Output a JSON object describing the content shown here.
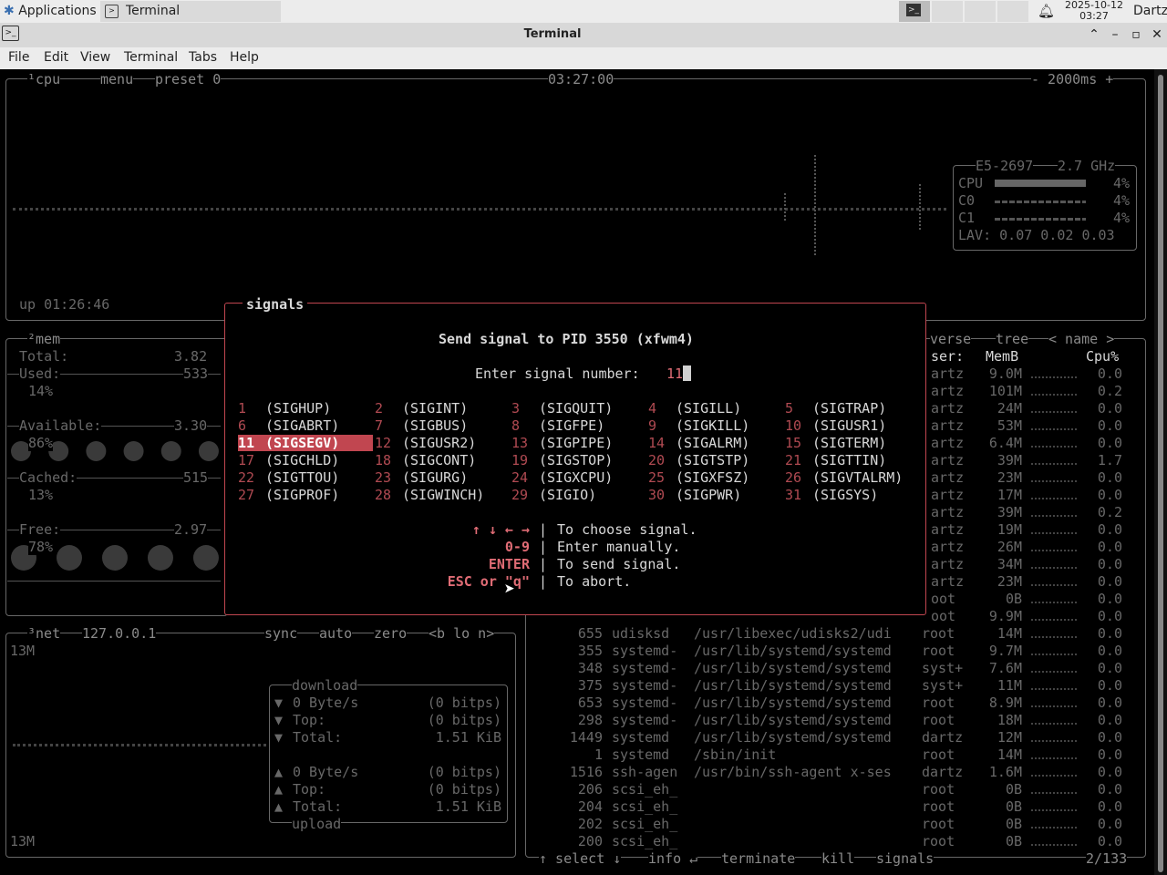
{
  "taskbar": {
    "applications_label": "Applications",
    "task_label": "Terminal",
    "date": "2025-10-12",
    "time": "03:27",
    "user": "Dartz"
  },
  "window": {
    "title": "Terminal",
    "menu": [
      "File",
      "Edit",
      "View",
      "Terminal",
      "Tabs",
      "Help"
    ]
  },
  "cpu_box": {
    "tab": "¹cpu",
    "menu": "menu",
    "preset": "preset 0",
    "clock": "03:27:00",
    "interval": "- 2000ms +",
    "uptime": "up 01:26:46",
    "model": "E5-2697",
    "freq": "2.7 GHz",
    "rows": [
      {
        "label": "CPU",
        "pct": "4%"
      },
      {
        "label": "C0",
        "pct": "4%"
      },
      {
        "label": "C1",
        "pct": "4%"
      }
    ],
    "lav": "LAV: 0.07 0.02 0.03"
  },
  "mem_box": {
    "tab": "²mem",
    "total_label": "Total:",
    "total_value": "3.82",
    "used_label": "Used:",
    "used_value": "533",
    "used_pct": "14%",
    "available_label": "Available:",
    "available_value": "3.30",
    "available_pct": "86%",
    "cached_label": "Cached:",
    "cached_value": "515",
    "cached_pct": "13%",
    "free_label": "Free:",
    "free_value": "2.97",
    "free_pct": "78%"
  },
  "net_box": {
    "tab": "³net",
    "ip": "127.0.0.1",
    "opts": [
      "sync",
      "auto",
      "zero",
      "<b lo n>"
    ],
    "scale_top": "13M",
    "scale_bottom": "13M",
    "download_title": "download",
    "upload_title": "upload",
    "download": [
      {
        "arrow": "▼",
        "label": "0 Byte/s",
        "value": "(0 bitps)"
      },
      {
        "arrow": "▼",
        "label": "Top:",
        "value": "(0 bitps)"
      },
      {
        "arrow": "▼",
        "label": "Total:",
        "value": "1.51 KiB"
      }
    ],
    "upload": [
      {
        "arrow": "▲",
        "label": "0 Byte/s",
        "value": "(0 bitps)"
      },
      {
        "arrow": "▲",
        "label": "Top:",
        "value": "(0 bitps)"
      },
      {
        "arrow": "▲",
        "label": "Total:",
        "value": "1.51 KiB"
      }
    ]
  },
  "proc_box": {
    "header_opts": [
      "verse",
      "tree",
      "< name >"
    ],
    "col_user": "ser:",
    "col_mem": "MemB",
    "col_cpu": "Cpu%",
    "partial_rows": [
      {
        "user": "artz",
        "mem": "9.0M",
        "cpu": "0.0"
      },
      {
        "user": "artz",
        "mem": "101M",
        "cpu": "0.2"
      },
      {
        "user": "artz",
        "mem": "24M",
        "cpu": "0.0"
      },
      {
        "user": "artz",
        "mem": "53M",
        "cpu": "0.0"
      },
      {
        "user": "artz",
        "mem": "6.4M",
        "cpu": "0.0"
      },
      {
        "user": "artz",
        "mem": "39M",
        "cpu": "1.7"
      },
      {
        "user": "artz",
        "mem": "23M",
        "cpu": "0.0"
      },
      {
        "user": "artz",
        "mem": "17M",
        "cpu": "0.0"
      },
      {
        "user": "artz",
        "mem": "39M",
        "cpu": "0.2"
      },
      {
        "user": "artz",
        "mem": "19M",
        "cpu": "0.0"
      },
      {
        "user": "artz",
        "mem": "26M",
        "cpu": "0.0"
      },
      {
        "user": "artz",
        "mem": "34M",
        "cpu": "0.0"
      },
      {
        "user": "artz",
        "mem": "23M",
        "cpu": "0.0"
      },
      {
        "user": "oot",
        "mem": "0B",
        "cpu": "0.0"
      },
      {
        "user": "oot",
        "mem": "9.9M",
        "cpu": "0.0"
      }
    ],
    "rows": [
      {
        "pid": "655",
        "name": "udisksd",
        "cmd": "/usr/libexec/udisks2/udi",
        "user": "root",
        "mem": "14M",
        "cpu": "0.0"
      },
      {
        "pid": "355",
        "name": "systemd-",
        "cmd": "/usr/lib/systemd/systemd",
        "user": "root",
        "mem": "9.7M",
        "cpu": "0.0"
      },
      {
        "pid": "348",
        "name": "systemd-",
        "cmd": "/usr/lib/systemd/systemd",
        "user": "syst+",
        "mem": "7.6M",
        "cpu": "0.0"
      },
      {
        "pid": "375",
        "name": "systemd-",
        "cmd": "/usr/lib/systemd/systemd",
        "user": "syst+",
        "mem": "11M",
        "cpu": "0.0"
      },
      {
        "pid": "653",
        "name": "systemd-",
        "cmd": "/usr/lib/systemd/systemd",
        "user": "root",
        "mem": "8.9M",
        "cpu": "0.0"
      },
      {
        "pid": "298",
        "name": "systemd-",
        "cmd": "/usr/lib/systemd/systemd",
        "user": "root",
        "mem": "18M",
        "cpu": "0.0"
      },
      {
        "pid": "1449",
        "name": "systemd",
        "cmd": "/usr/lib/systemd/systemd",
        "user": "dartz",
        "mem": "12M",
        "cpu": "0.0"
      },
      {
        "pid": "1",
        "name": "systemd",
        "cmd": "/sbin/init",
        "user": "root",
        "mem": "14M",
        "cpu": "0.0"
      },
      {
        "pid": "1516",
        "name": "ssh-agen",
        "cmd": "/usr/bin/ssh-agent x-ses",
        "user": "dartz",
        "mem": "1.6M",
        "cpu": "0.0"
      },
      {
        "pid": "206",
        "name": "scsi_eh_",
        "cmd": "",
        "user": "root",
        "mem": "0B",
        "cpu": "0.0"
      },
      {
        "pid": "204",
        "name": "scsi_eh_",
        "cmd": "",
        "user": "root",
        "mem": "0B",
        "cpu": "0.0"
      },
      {
        "pid": "202",
        "name": "scsi_eh_",
        "cmd": "",
        "user": "root",
        "mem": "0B",
        "cpu": "0.0"
      },
      {
        "pid": "200",
        "name": "scsi_eh_",
        "cmd": "",
        "user": "root",
        "mem": "0B",
        "cpu": "0.0"
      }
    ],
    "footer": {
      "select": "↑ select ↓",
      "info": "info ↵",
      "terminate": "terminate",
      "kill": "kill",
      "signals": "signals",
      "count": "2/133"
    }
  },
  "signal_dialog": {
    "title": "signals",
    "heading": "Send signal to PID 3550 (xfwm4)",
    "prompt": "Enter signal number: ",
    "input_value": "11",
    "selected": 11,
    "signals": [
      {
        "num": "1",
        "name": "(SIGHUP)"
      },
      {
        "num": "2",
        "name": "(SIGINT)"
      },
      {
        "num": "3",
        "name": "(SIGQUIT)"
      },
      {
        "num": "4",
        "name": "(SIGILL)"
      },
      {
        "num": "5",
        "name": "(SIGTRAP)"
      },
      {
        "num": "6",
        "name": "(SIGABRT)"
      },
      {
        "num": "7",
        "name": "(SIGBUS)"
      },
      {
        "num": "8",
        "name": "(SIGFPE)"
      },
      {
        "num": "9",
        "name": "(SIGKILL)"
      },
      {
        "num": "10",
        "name": "(SIGUSR1)"
      },
      {
        "num": "11",
        "name": "(SIGSEGV)"
      },
      {
        "num": "12",
        "name": "(SIGUSR2)"
      },
      {
        "num": "13",
        "name": "(SIGPIPE)"
      },
      {
        "num": "14",
        "name": "(SIGALRM)"
      },
      {
        "num": "15",
        "name": "(SIGTERM)"
      },
      {
        "num": "17",
        "name": "(SIGCHLD)"
      },
      {
        "num": "18",
        "name": "(SIGCONT)"
      },
      {
        "num": "19",
        "name": "(SIGSTOP)"
      },
      {
        "num": "20",
        "name": "(SIGTSTP)"
      },
      {
        "num": "21",
        "name": "(SIGTTIN)"
      },
      {
        "num": "22",
        "name": "(SIGTTOU)"
      },
      {
        "num": "23",
        "name": "(SIGURG)"
      },
      {
        "num": "24",
        "name": "(SIGXCPU)"
      },
      {
        "num": "25",
        "name": "(SIGXFSZ)"
      },
      {
        "num": "26",
        "name": "(SIGVTALRM)"
      },
      {
        "num": "27",
        "name": "(SIGPROF)"
      },
      {
        "num": "28",
        "name": "(SIGWINCH)"
      },
      {
        "num": "29",
        "name": "(SIGIO)"
      },
      {
        "num": "30",
        "name": "(SIGPWR)"
      },
      {
        "num": "31",
        "name": "(SIGSYS)"
      }
    ],
    "help": [
      {
        "key": "↑ ↓ ← →",
        "desc": "To choose signal."
      },
      {
        "key": "0-9",
        "desc": "Enter manually."
      },
      {
        "key": "ENTER",
        "desc": "To send signal."
      },
      {
        "key": "ESC or \"q\"",
        "desc": "To abort."
      }
    ]
  },
  "colors": {
    "accent": "#c14650",
    "border": "#686868",
    "background": "#000000"
  }
}
